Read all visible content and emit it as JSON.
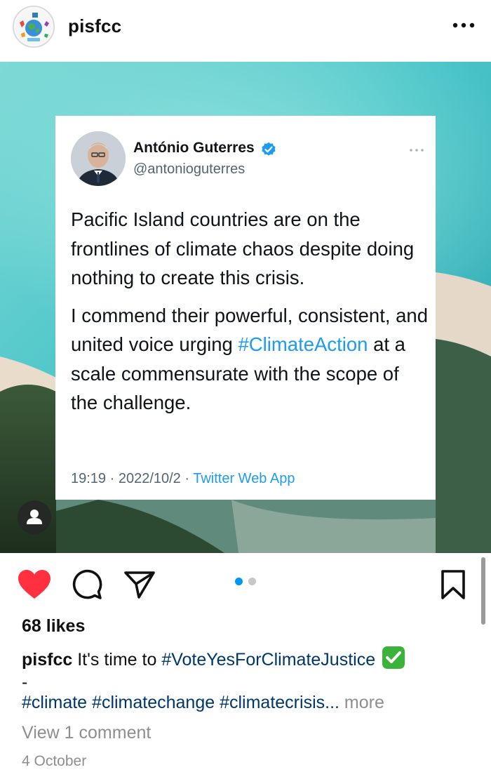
{
  "post": {
    "username": "pisfcc",
    "likes": "68 likes",
    "caption_user": "pisfcc",
    "caption_text": "It's time to ",
    "caption_hashtag": "#VoteYesForClimateJustice",
    "caption_line2": "-",
    "hashtags": "#climate #climatechange #climatecrisis...",
    "more_label": "more",
    "view_comments": "View 1 comment",
    "date": "4 October",
    "carousel_count": 2,
    "carousel_active": 1
  },
  "tweet": {
    "name": "António Guterres",
    "handle": "@antonioguterres",
    "paragraph1": "Pacific Island countries are on the frontlines of climate chaos despite doing nothing to create this crisis.",
    "paragraph2_before": "I commend their powerful, consistent, and united voice urging ",
    "paragraph2_hashtag": "#ClimateAction",
    "paragraph2_after": " at a scale commensurate with the scope of the challenge.",
    "timestamp": "19:19 · 2022/10/2 · ",
    "source": "Twitter Web App"
  },
  "icons": {
    "more": "more-horizontal-icon",
    "like": "heart-icon",
    "comment": "comment-icon",
    "share": "paper-plane-icon",
    "save": "bookmark-icon",
    "tag": "user-tag-icon",
    "verified": "verified-badge-icon",
    "check": "check-mark-emoji"
  },
  "colors": {
    "like_red": "#ff3040",
    "link_blue": "#00376b",
    "twitter_blue": "#1d9bf0",
    "muted_gray": "#8e8e8e",
    "carousel_active": "#0095f6",
    "carousel_inactive": "#c7c7c7",
    "check_green": "#3bb33b"
  }
}
